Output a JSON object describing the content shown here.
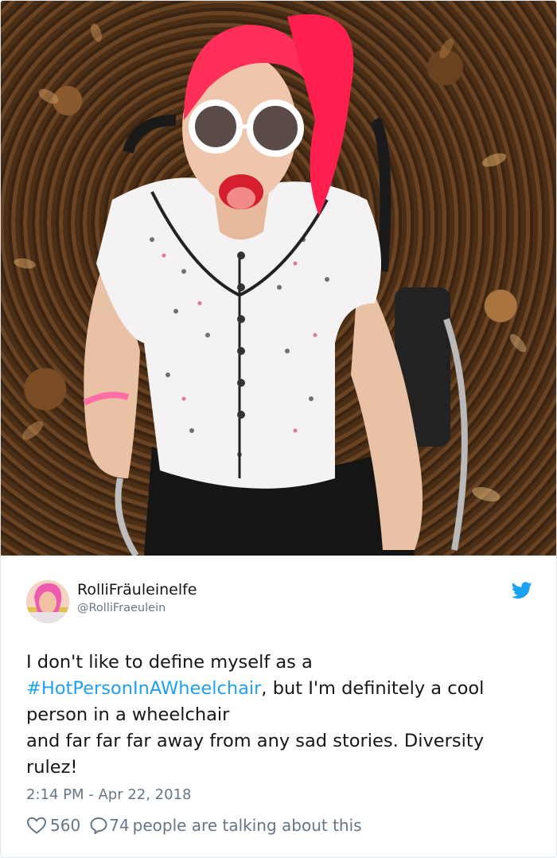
{
  "tweet": {
    "user_name": "RolliFräuleinelfe",
    "user_handle": "@RolliFraeulein",
    "text_line1": "I don't like to define myself as a",
    "hashtag": "#HotPersonInAWheelchair",
    "text_line2_rest": ", but I'm definitely a cool",
    "text_line3": "person in a wheelchair",
    "text_line4": "and far far far away from any sad stories.  Diversity",
    "text_line5": "rulez!",
    "timestamp": "2:14 PM - Apr 22, 2018",
    "likes": "560",
    "replies": "74",
    "talking_text": "people are talking about this"
  },
  "colors": {
    "hashtag": "#1da1f2",
    "twitter_blue": "#1da1f2",
    "meta_gray": "#657786"
  },
  "icons": [
    "twitter-bird-icon",
    "heart-icon",
    "comment-icon"
  ]
}
